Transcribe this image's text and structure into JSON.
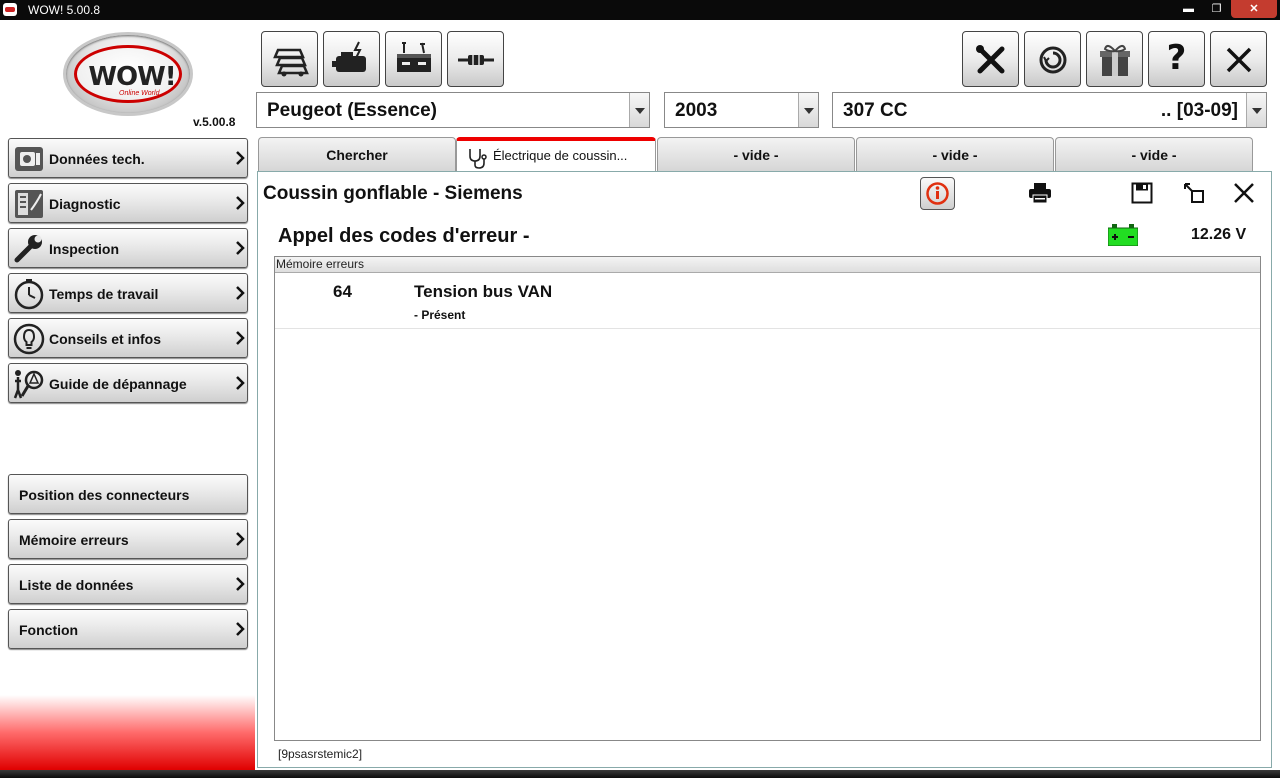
{
  "window": {
    "title": "WOW! 5.00.8",
    "minimize": "▬",
    "maximize": "❐",
    "close": "✕"
  },
  "logo": {
    "text": "WOW!",
    "subtitle": "Online World",
    "version": "v.5.00.8"
  },
  "left_nav": {
    "main": [
      {
        "label": "Données tech.",
        "icon": "engine-data-icon"
      },
      {
        "label": "Diagnostic",
        "icon": "diagnostic-icon"
      },
      {
        "label": "Inspection",
        "icon": "wrench-icon"
      },
      {
        "label": "Temps de travail",
        "icon": "stopwatch-icon"
      },
      {
        "label": "Conseils et infos",
        "icon": "lightbulb-icon"
      },
      {
        "label": "Guide de dépannage",
        "icon": "troubleshoot-icon"
      }
    ],
    "secondary": [
      {
        "label": "Position des connecteurs",
        "chevron": false
      },
      {
        "label": "Mémoire erreurs",
        "chevron": true
      },
      {
        "label": "Liste de données",
        "chevron": true
      },
      {
        "label": "Fonction",
        "chevron": true
      }
    ]
  },
  "toolbar": {
    "left": [
      "cars-icon",
      "engine-spark-icon",
      "battery-tools-icon",
      "connector-icon"
    ],
    "right": [
      "tools-icon",
      "sync-icon",
      "gift-icon",
      "help-icon",
      "exit-icon"
    ],
    "help_glyph": "?"
  },
  "vehicle": {
    "make": "Peugeot (Essence)",
    "year": "2003",
    "model": "307 CC",
    "model_range": ".. [03-09]"
  },
  "tabs": [
    {
      "label": "Chercher",
      "active": false
    },
    {
      "label": "Électrique de coussin...",
      "active": true
    },
    {
      "label": "- vide -",
      "active": false
    },
    {
      "label": "- vide -",
      "active": false
    },
    {
      "label": "- vide -",
      "active": false
    }
  ],
  "content": {
    "title": "Coussin gonflable - Siemens",
    "subtitle": "Appel des codes d'erreur -",
    "voltage": "12.26 V",
    "battery_color": "#22dd22",
    "table_header": "Mémoire erreurs",
    "errors": [
      {
        "code": "64",
        "description": "Tension bus VAN",
        "status": "- Présent"
      }
    ],
    "footer": "[9psasrstemic2]"
  },
  "colors": {
    "accent": "#e00000",
    "active_tab_border": "#e00000"
  }
}
